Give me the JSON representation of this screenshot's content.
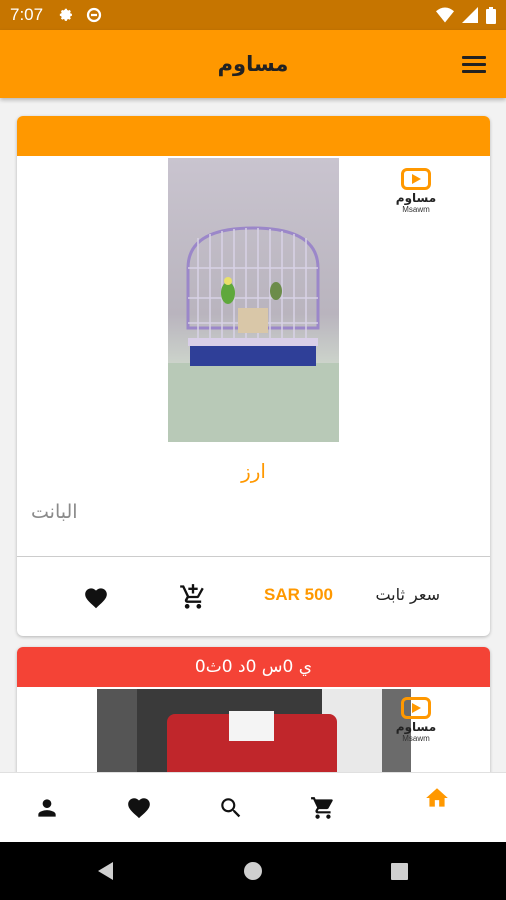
{
  "status_bar": {
    "time": "7:07"
  },
  "app_bar": {
    "title": "مساوم"
  },
  "logo": {
    "arabic": "مساوم",
    "latin": "Msawm"
  },
  "listings": [
    {
      "header": "",
      "name": "ارز",
      "description": "البانت",
      "price": "SAR 500",
      "price_type": "سعر ثابت"
    },
    {
      "header": "0ي 0س 0د 0ث"
    }
  ],
  "colors": {
    "primary": "#ff9800",
    "status_bar": "#c67500",
    "countdown": "#f44336"
  },
  "bottom_nav": [
    "profile-icon",
    "favorite-icon",
    "search-icon",
    "cart-icon",
    "home-icon"
  ]
}
